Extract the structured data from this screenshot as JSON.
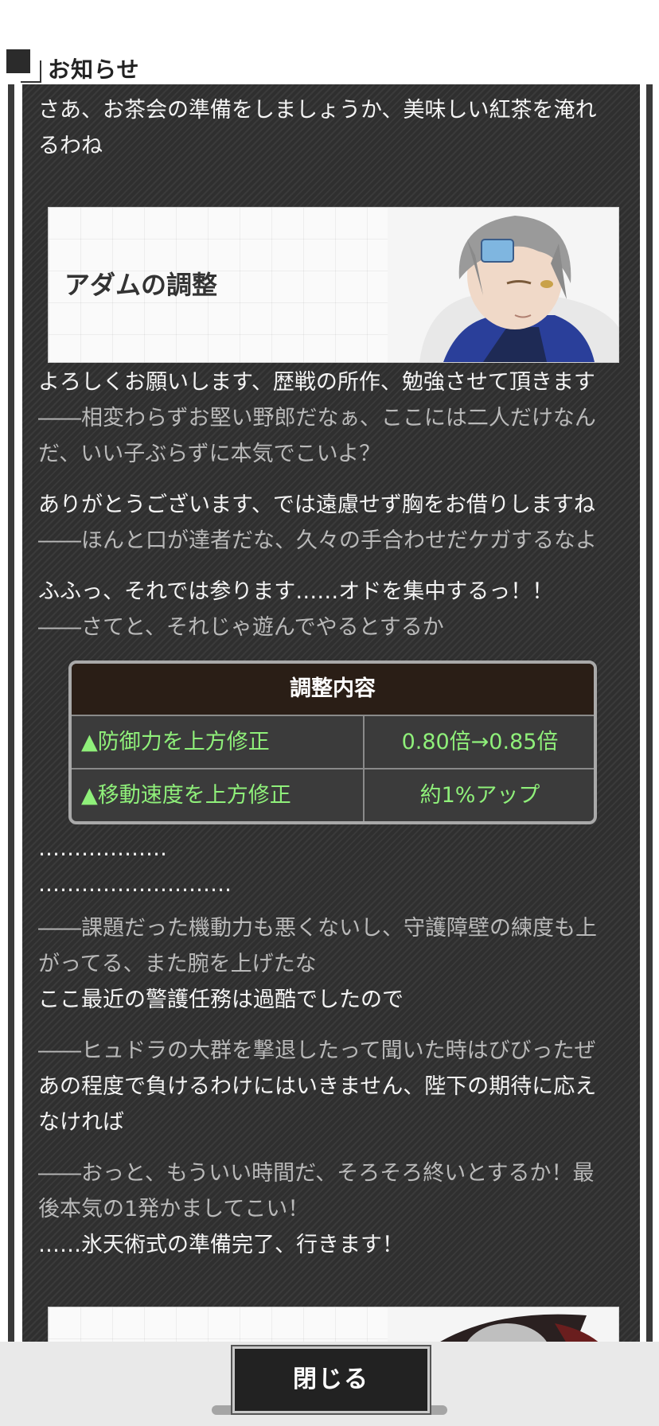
{
  "header": {
    "title": "お知らせ"
  },
  "content": {
    "intro_lines": [
      "さあ、お茶会の準備をしましょうか、美味しい紅茶を淹れ",
      "るわね"
    ],
    "banner1": {
      "title": "アダムの調整"
    },
    "dialogue_a": [
      "よろしくお願いします、歴戦の所作、勉強させて頂きます",
      "――相変わらずお堅い野郎だなぁ、ここには二人だけなん",
      "だ、いい子ぶらずに本気でこいよ？",
      "ありがとうございます、では遠慮せず胸をお借りしますね",
      "――ほんと口が達者だな、久々の手合わせだケガするなよ",
      "ふふっ、それでは参ります……オドを集中するっ！！",
      "――さてと、それじゃ遊んでやるとするか"
    ],
    "table": {
      "header": "調整内容",
      "rows": [
        {
          "label": "▲防御力を上方修正",
          "value": "0.80倍→0.85倍"
        },
        {
          "label": "▲移動速度を上方修正",
          "value": "約1%アップ"
        }
      ]
    },
    "dialogue_b": [
      "………………",
      "………………………",
      "――課題だった機動力も悪くないし、守護障壁の練度も上",
      "がってる、また腕を上げたな",
      "ここ最近の警護任務は過酷でしたので",
      "――ヒュドラの大群を撃退したって聞いた時はびびったぜ",
      "あの程度で負けるわけにはいきません、陛下の期待に応え",
      "なければ",
      "――おっと、もういい時間だ、そろそろ終いとするか！最",
      "後本気の1発かましてこい！",
      "……氷天術式の準備完了、行きます！"
    ]
  },
  "footer": {
    "close_label": "閉じる"
  },
  "colors": {
    "accent_green": "#8ff07a",
    "panel_bg": "#2f2f2f",
    "table_header_bg": "#2a1e16"
  }
}
